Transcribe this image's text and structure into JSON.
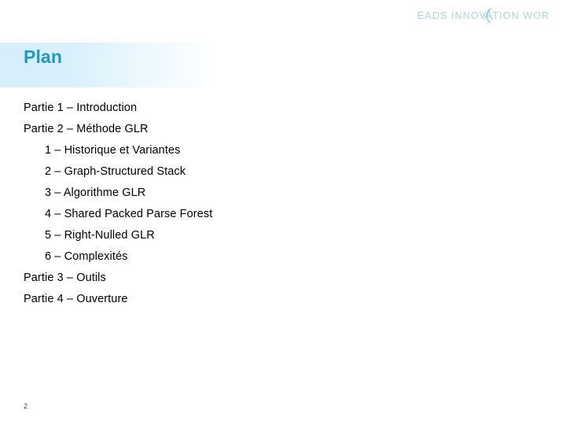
{
  "brand": {
    "logo_text": "EADS INNOVATION WORKS",
    "logo_part1": "EADS INNOV",
    "logo_part2": "TION WORKS",
    "logo_color": "#a8d4e8",
    "logo_accent_color": "#7fc4e0"
  },
  "header": {
    "title": "Plan",
    "title_color": "#2196c8",
    "band_color_start": "#d5effb",
    "band_color_end": "#ffffff"
  },
  "agenda": {
    "items": [
      {
        "text": "Partie 1 – Introduction",
        "level": 1
      },
      {
        "text": "Partie 2 – Méthode GLR",
        "level": 1
      },
      {
        "text": "1 – Historique et Variantes",
        "level": 2
      },
      {
        "text": "2 – Graph-Structured Stack",
        "level": 2
      },
      {
        "text": "3 – Algorithme GLR",
        "level": 2
      },
      {
        "text": "4 – Shared Packed Parse Forest",
        "level": 2
      },
      {
        "text": "5 – Right-Nulled GLR",
        "level": 2
      },
      {
        "text": "6 – Complexités",
        "level": 2
      },
      {
        "text": "Partie 3 – Outils",
        "level": 1
      },
      {
        "text": "Partie 4 – Ouverture",
        "level": 1
      }
    ]
  },
  "footer": {
    "page_number": "2",
    "page_number_color": "#23596b"
  }
}
